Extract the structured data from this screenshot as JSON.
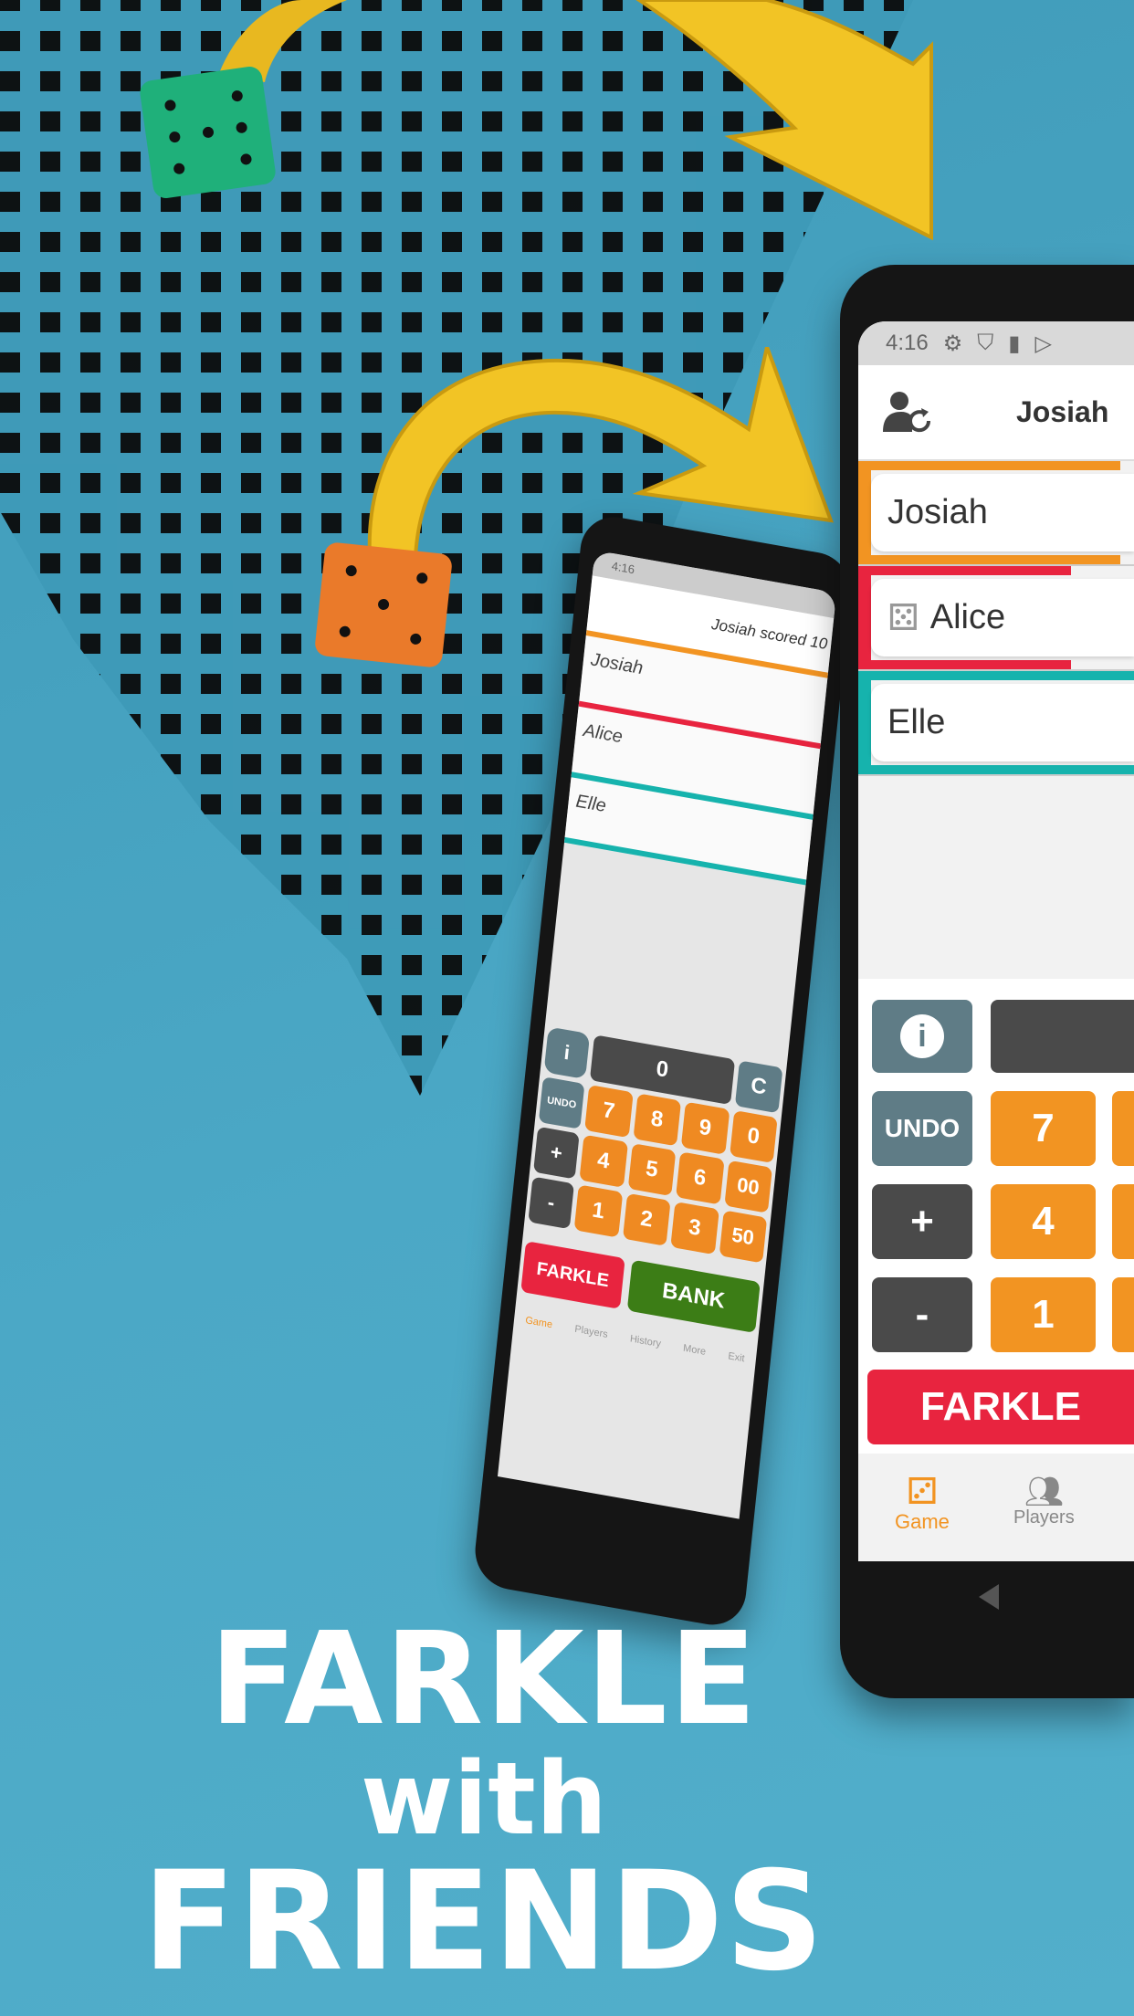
{
  "headline": {
    "line1": "FARKLE",
    "line2": "with",
    "line3": "FRIENDS"
  },
  "colors": {
    "background": "#4aa6c4",
    "orange": "#f29422",
    "red": "#e8243f",
    "green": "#3c7d16",
    "teal": "#16b3ad",
    "slate": "#5f7c86",
    "dark": "#4a4a4a"
  },
  "phone": {
    "status": {
      "time": "4:16",
      "icons": [
        "gear-icon",
        "shield-icon",
        "sd-card-icon",
        "play-store-icon"
      ]
    },
    "header": {
      "title": "Josiah"
    },
    "players": [
      {
        "name": "Josiah",
        "color": "#f29422",
        "progress": 0.95,
        "icon": ""
      },
      {
        "name": "Alice",
        "color": "#e8243f",
        "progress": 0.77,
        "icon": "dice-icon"
      },
      {
        "name": "Elle",
        "color": "#16b3ad",
        "progress": 1.0,
        "icon": ""
      }
    ],
    "keypad": {
      "info": "i",
      "undo": "UNDO",
      "plus": "+",
      "minus": "-",
      "keys": [
        "7",
        "4",
        "1"
      ],
      "farkle": "FARKLE"
    },
    "nav": [
      {
        "label": "Game",
        "active": true
      },
      {
        "label": "Players",
        "active": false
      }
    ]
  },
  "phone_small": {
    "header": {
      "title": "Josiah scored 10"
    },
    "players": [
      "Josiah",
      "Alice",
      "Elle"
    ],
    "display": "0",
    "clear": "C",
    "undo": "UNDO",
    "plus": "+",
    "minus": "-",
    "keys": [
      "7",
      "8",
      "9",
      "0",
      "4",
      "5",
      "6",
      "00",
      "1",
      "2",
      "3",
      "50"
    ],
    "farkle": "FARKLE",
    "bank": "BANK",
    "nav": [
      "Game",
      "Players",
      "History",
      "More",
      "Exit"
    ]
  }
}
